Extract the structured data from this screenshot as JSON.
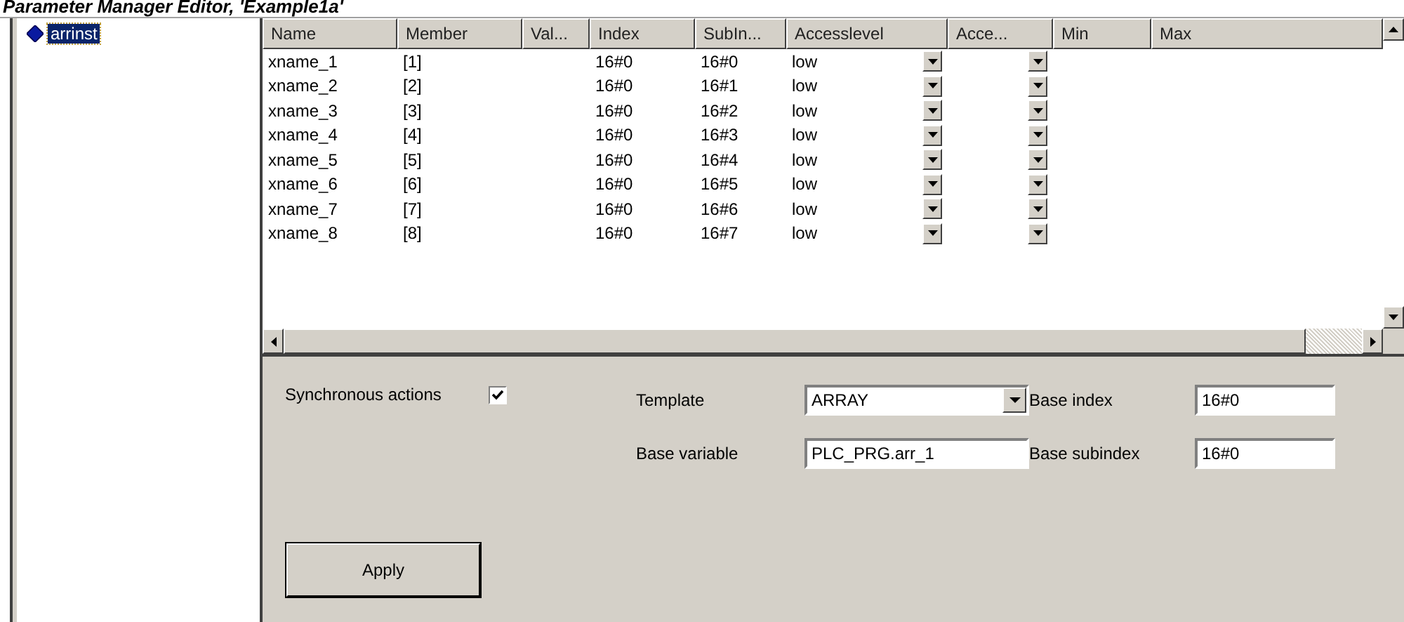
{
  "window": {
    "title": "Parameter Manager Editor, 'Example1a'"
  },
  "tree": {
    "items": [
      {
        "label": "arrinst",
        "selected": true
      }
    ]
  },
  "table": {
    "columns": [
      {
        "label": "Name",
        "kind": "text"
      },
      {
        "label": "Member",
        "kind": "text"
      },
      {
        "label": "Val...",
        "kind": "text"
      },
      {
        "label": "Index",
        "kind": "text"
      },
      {
        "label": "SubIn...",
        "kind": "text"
      },
      {
        "label": "Accesslevel",
        "kind": "dropdown"
      },
      {
        "label": "Acce...",
        "kind": "dropdown"
      },
      {
        "label": "Min",
        "kind": "text"
      },
      {
        "label": "Max",
        "kind": "text"
      }
    ],
    "rows": [
      {
        "cells": [
          "xname_1",
          "[1]",
          "",
          "16#0",
          "16#0",
          "low",
          "",
          "",
          ""
        ]
      },
      {
        "cells": [
          "xname_2",
          "[2]",
          "",
          "16#0",
          "16#1",
          "low",
          "",
          "",
          ""
        ]
      },
      {
        "cells": [
          "xname_3",
          "[3]",
          "",
          "16#0",
          "16#2",
          "low",
          "",
          "",
          ""
        ]
      },
      {
        "cells": [
          "xname_4",
          "[4]",
          "",
          "16#0",
          "16#3",
          "low",
          "",
          "",
          ""
        ]
      },
      {
        "cells": [
          "xname_5",
          "[5]",
          "",
          "16#0",
          "16#4",
          "low",
          "",
          "",
          ""
        ]
      },
      {
        "cells": [
          "xname_6",
          "[6]",
          "",
          "16#0",
          "16#5",
          "low",
          "",
          "",
          ""
        ]
      },
      {
        "cells": [
          "xname_7",
          "[7]",
          "",
          "16#0",
          "16#6",
          "low",
          "",
          "",
          ""
        ]
      },
      {
        "cells": [
          "xname_8",
          "[8]",
          "",
          "16#0",
          "16#7",
          "low",
          "",
          "",
          ""
        ]
      }
    ]
  },
  "settings": {
    "synchronous_actions": {
      "label": "Synchronous actions",
      "checked": true
    },
    "template": {
      "label": "Template",
      "value": "ARRAY"
    },
    "base_variable": {
      "label": "Base variable",
      "value": "PLC_PRG.arr_1"
    },
    "base_index": {
      "label": "Base index",
      "value": "16#0"
    },
    "base_subindex": {
      "label": "Base subindex",
      "value": "16#0"
    },
    "apply_button": "Apply"
  }
}
